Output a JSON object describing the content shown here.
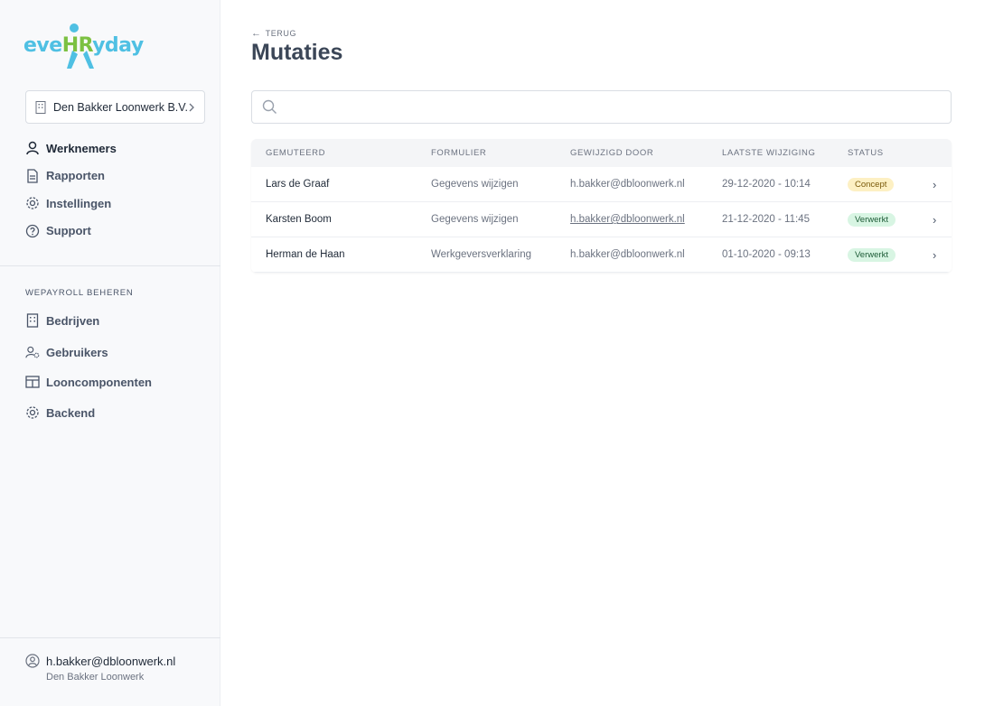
{
  "brand": {
    "logo_prefix": "eve",
    "logo_hr": "HR",
    "logo_suffix": "yday",
    "colors": {
      "primary": "#4fc0e3",
      "accent": "#7cc142"
    }
  },
  "sidebar": {
    "company_select": {
      "label": "Den Bakker Loonwerk B.V.",
      "icon": "building-icon"
    },
    "items": [
      {
        "label": "Werknemers",
        "icon": "user-icon",
        "active": true
      },
      {
        "label": "Rapporten",
        "icon": "document-icon"
      },
      {
        "label": "Instellingen",
        "icon": "gear-icon"
      },
      {
        "label": "Support",
        "icon": "question-icon"
      }
    ],
    "section_label": "WEPAYROLL BEHEREN",
    "admin_items": [
      {
        "label": "Bedrijven",
        "icon": "building-icon"
      },
      {
        "label": "Gebruikers",
        "icon": "user-gear-icon"
      },
      {
        "label": "Looncomponenten",
        "icon": "table-icon"
      },
      {
        "label": "Backend",
        "icon": "gear-icon"
      }
    ],
    "user": {
      "email": "h.bakker@dbloonwerk.nl",
      "company": "Den Bakker Loonwerk"
    }
  },
  "main": {
    "back_label": "TERUG",
    "title": "Mutaties",
    "search": {
      "placeholder": "",
      "value": ""
    },
    "table": {
      "headers": [
        "GEMUTEERD",
        "FORMULIER",
        "GEWIJZIGD DOOR",
        "LAATSTE WIJZIGING",
        "STATUS"
      ],
      "rows": [
        {
          "name": "Lars de Graaf",
          "form": "Gegevens wijzigen",
          "by": "h.bakker@dbloonwerk.nl",
          "date": "29-12-2020 - 10:14",
          "status": "Concept"
        },
        {
          "name": "Karsten Boom",
          "form": "Gegevens wijzigen",
          "by": "h.bakker@dbloonwerk.nl",
          "date": "21-12-2020 - 11:45",
          "status": "Verwerkt"
        },
        {
          "name": "Herman de Haan",
          "form": "Werkgeversverklaring",
          "by": "h.bakker@dbloonwerk.nl",
          "date": "01-10-2020 - 09:13",
          "status": "Verwerkt"
        }
      ]
    }
  }
}
